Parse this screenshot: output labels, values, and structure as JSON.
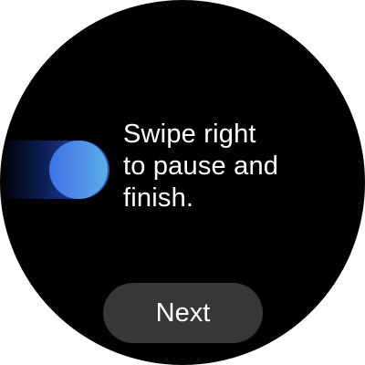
{
  "instruction": {
    "lines": [
      "Swipe right",
      "to pause and",
      "finish."
    ]
  },
  "swipe_control": {
    "icon": "swipe-right-handle"
  },
  "next_button": {
    "label": "Next"
  },
  "colors": {
    "background": "#000000",
    "text": "#ffffff",
    "button_bg": "#373737",
    "knob_start": "#3f73e6",
    "knob_end": "#5ab0e6"
  }
}
